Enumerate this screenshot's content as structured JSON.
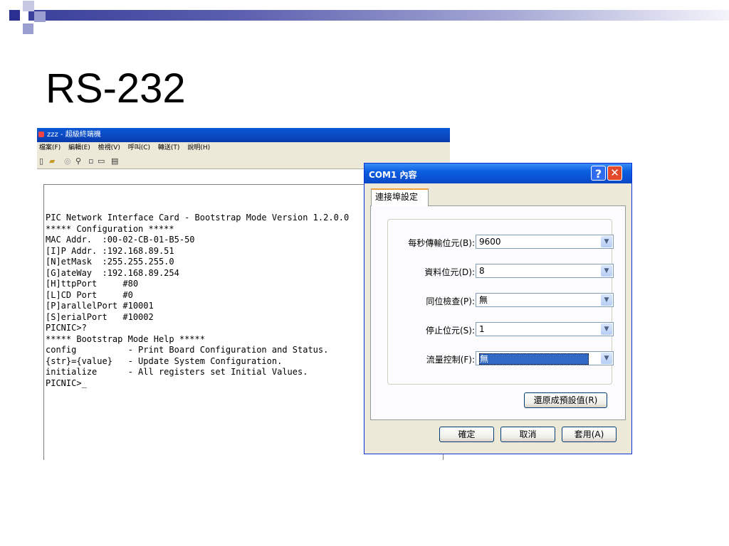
{
  "slide": {
    "title": "RS-232"
  },
  "terminal": {
    "title": "zzz - 超級終端機",
    "menu": [
      "檔案(F)",
      "編輯(E)",
      "檢視(V)",
      "呼叫(C)",
      "轉送(T)",
      "說明(H)"
    ],
    "lines": [
      "PIC Network Interface Card - Bootstrap Mode Version 1.2.0.0",
      "***** Configuration *****",
      "MAC Addr.  :00-02-CB-01-B5-50",
      "[I]P Addr. :192.168.89.51",
      "[N]etMask  :255.255.255.0",
      "[G]ateWay  :192.168.89.254",
      "[H]ttpPort     #80",
      "[L]CD Port     #0",
      "[P]arallelPort #10001",
      "[S]erialPort   #10002",
      "PICNIC>?",
      "***** Bootstrap Mode Help *****",
      "config          - Print Board Configuration and Status.",
      "{str}={value}   - Update System Configuration.",
      "initialize      - All registers set Initial Values.",
      "PICNIC>_"
    ]
  },
  "dialog": {
    "title": "COM1 內容",
    "help_label": "?",
    "close_label": "✕",
    "tab_label": "連接埠設定",
    "fields": [
      {
        "label": "每秒傳輸位元(B):",
        "value": "9600"
      },
      {
        "label": "資料位元(D):",
        "value": "8"
      },
      {
        "label": "同位檢查(P):",
        "value": "無"
      },
      {
        "label": "停止位元(S):",
        "value": "1"
      },
      {
        "label": "流量控制(F):",
        "value": "無"
      }
    ],
    "restore_button": "還原成預設值(R)",
    "ok_button": "確定",
    "cancel_button": "取消",
    "apply_button": "套用(A)"
  }
}
